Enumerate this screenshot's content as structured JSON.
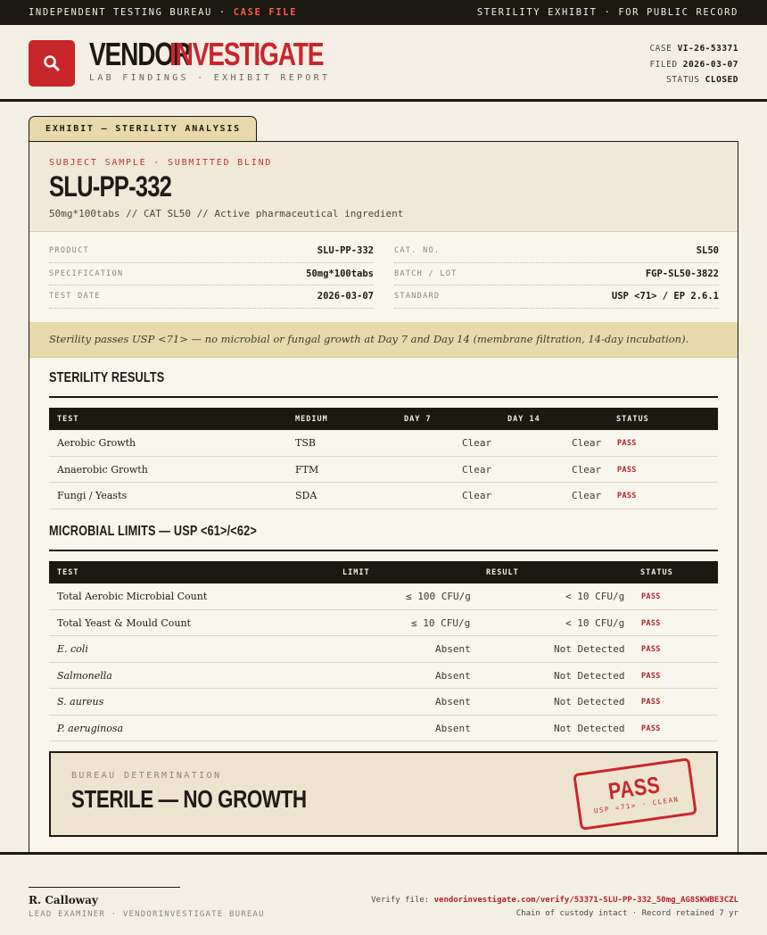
{
  "topbar": {
    "left_text": "INDEPENDENT TESTING BUREAU · ",
    "left_highlight": "CASE FILE",
    "right_text": "STERILITY EXHIBIT · FOR PUBLIC RECORD"
  },
  "header": {
    "brand_part1": "VENDOR",
    "brand_part2": "INVESTIGATE",
    "tagline": "LAB FINDINGS · EXHIBIT REPORT",
    "logo_icon": "magnifier-icon",
    "case_label": "CASE",
    "case_value": "VI-26-53371",
    "filed_label": "FILED",
    "filed_value": "2026-03-07",
    "status_label": "STATUS",
    "status_value": "CLOSED"
  },
  "exhibit_tab": "EXHIBIT — STERILITY ANALYSIS",
  "subject": {
    "eyebrow": "SUBJECT SAMPLE · SUBMITTED BLIND",
    "sku": "SLU-PP-332",
    "description": "50mg*100tabs  //  CAT SL50  //  Active pharmaceutical ingredient"
  },
  "specs": {
    "left": [
      {
        "key": "PRODUCT",
        "value": "SLU-PP-332"
      },
      {
        "key": "SPECIFICATION",
        "value": "50mg*100tabs"
      },
      {
        "key": "TEST DATE",
        "value": "2026-03-07"
      }
    ],
    "right": [
      {
        "key": "CAT. NO.",
        "value": "SL50"
      },
      {
        "key": "BATCH / LOT",
        "value": "FGP-SL50-3822"
      },
      {
        "key": "STANDARD",
        "value": "USP <71> / EP 2.6.1"
      }
    ]
  },
  "note": "Sterility passes USP <71> — no microbial or fungal growth at Day 7 and Day 14 (membrane filtration, 14-day incubation).",
  "sterility": {
    "title": "STERILITY RESULTS",
    "headers": [
      "TEST",
      "MEDIUM",
      "DAY 7",
      "DAY 14",
      "STATUS"
    ],
    "rows": [
      {
        "test": "Aerobic Growth",
        "medium": "TSB",
        "day7": "Clear",
        "day14": "Clear",
        "status": "PASS"
      },
      {
        "test": "Anaerobic Growth",
        "medium": "FTM",
        "day7": "Clear",
        "day14": "Clear",
        "status": "PASS"
      },
      {
        "test": "Fungi / Yeasts",
        "medium": "SDA",
        "day7": "Clear",
        "day14": "Clear",
        "status": "PASS"
      }
    ]
  },
  "microbial": {
    "title": "MICROBIAL LIMITS — USP <61>/<62>",
    "headers": [
      "TEST",
      "LIMIT",
      "RESULT",
      "STATUS"
    ],
    "rows": [
      {
        "test": "Total Aerobic Microbial Count",
        "limit": "≤ 100 CFU/g",
        "result": "< 10 CFU/g",
        "status": "PASS"
      },
      {
        "test": "Total Yeast & Mould Count",
        "limit": "≤ 10 CFU/g",
        "result": "< 10 CFU/g",
        "status": "PASS"
      },
      {
        "test": "E. coli",
        "limit": "Absent",
        "result": "Not Detected",
        "status": "PASS"
      },
      {
        "test": "Salmonella",
        "limit": "Absent",
        "result": "Not Detected",
        "status": "PASS"
      },
      {
        "test": "S. aureus",
        "limit": "Absent",
        "result": "Not Detected",
        "status": "PASS"
      },
      {
        "test": "P. aeruginosa",
        "limit": "Absent",
        "result": "Not Detected",
        "status": "PASS"
      }
    ]
  },
  "determination": {
    "eyebrow": "BUREAU DETERMINATION",
    "text": "STERILE — NO GROWTH",
    "stamp_main": "PASS",
    "stamp_sub": "USP <71> · CLEAN"
  },
  "footer": {
    "signatory": "R. Calloway",
    "role": "LEAD EXAMINER · VENDORINVESTIGATE BUREAU",
    "verify_label": "Verify file: ",
    "verify_url": "vendorinvestigate.com/verify/53371-SLU-PP-332_50mg_AG8SKWBE3CZL",
    "custody": "Chain of custody intact · Record retained 7 yr"
  },
  "colors": {
    "accent_red": "#c9262c",
    "ink": "#1b1812",
    "paper": "#f3efe4",
    "tan": "#e8d9ac"
  }
}
